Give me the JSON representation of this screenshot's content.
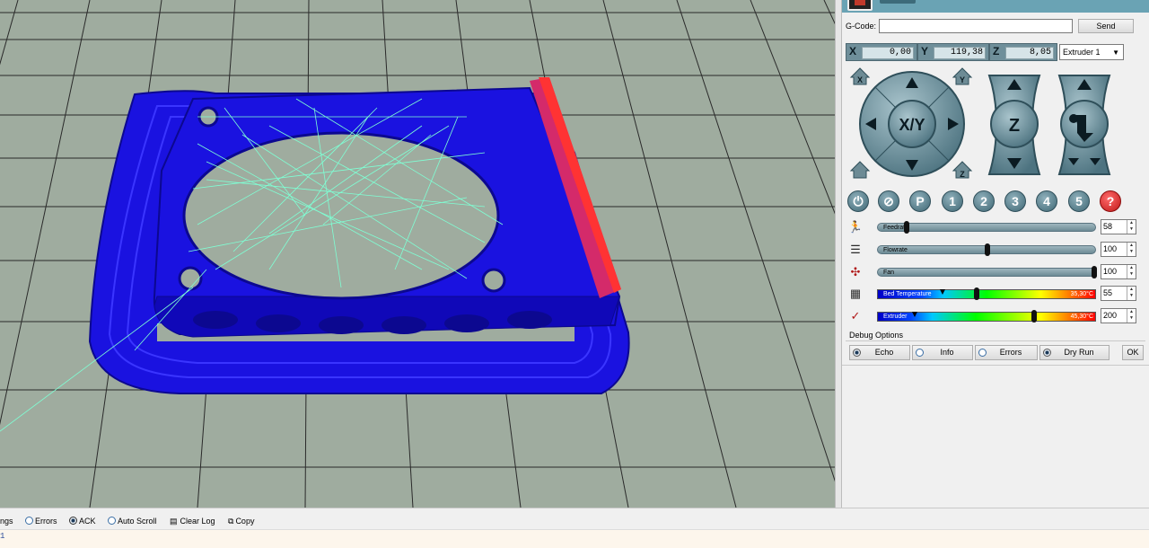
{
  "gcode": {
    "label": "G-Code:",
    "value": "",
    "send_label": "Send"
  },
  "coords": [
    {
      "axis": "X",
      "value": "0,00"
    },
    {
      "axis": "Y",
      "value": "119,38"
    },
    {
      "axis": "Z",
      "value": "8,05"
    }
  ],
  "extruder_select": {
    "value": "Extruder 1"
  },
  "jog": {
    "xy_label": "X/Y",
    "z_label": "Z",
    "home_x": "X",
    "home_y": "Y",
    "home_z": "Z"
  },
  "quick_buttons": [
    "1",
    "2",
    "3",
    "4",
    "5"
  ],
  "quick_extra": {
    "park": "P",
    "help": "?"
  },
  "sliders": [
    {
      "label": "Feedrate",
      "value": "58",
      "fraction": 0.12
    },
    {
      "label": "Flowrate",
      "value": "100",
      "fraction": 0.5
    },
    {
      "label": "Fan",
      "value": "100",
      "fraction": 1.0
    }
  ],
  "temps": [
    {
      "label": "Bed Temperature",
      "reading": "35,30°C",
      "setpoint": "55",
      "current_fraction": 0.29,
      "target_fraction": 0.45
    },
    {
      "label": "Extruder",
      "reading": "45,30°C",
      "setpoint": "200",
      "current_fraction": 0.16,
      "target_fraction": 0.72
    }
  ],
  "debug": {
    "title": "Debug Options",
    "options": [
      "Echo",
      "Info",
      "Errors",
      "Dry Run"
    ],
    "ok_label": "OK"
  },
  "log_toolbar": {
    "items": [
      {
        "label": "ngs",
        "kind": "text"
      },
      {
        "label": "Errors",
        "kind": "radio",
        "on": false
      },
      {
        "label": "ACK",
        "kind": "radio",
        "on": true
      },
      {
        "label": "Auto Scroll",
        "kind": "radio",
        "on": false
      },
      {
        "label": "Clear Log",
        "kind": "icon"
      },
      {
        "label": "Copy",
        "kind": "icon"
      }
    ]
  },
  "log_lines": [
    "1"
  ],
  "colors": {
    "bed": "#9fac9f",
    "grid": "#2a2a2a",
    "part": "#1410e6",
    "travel": "#7fffd4",
    "accent": "#6aa3b4"
  }
}
